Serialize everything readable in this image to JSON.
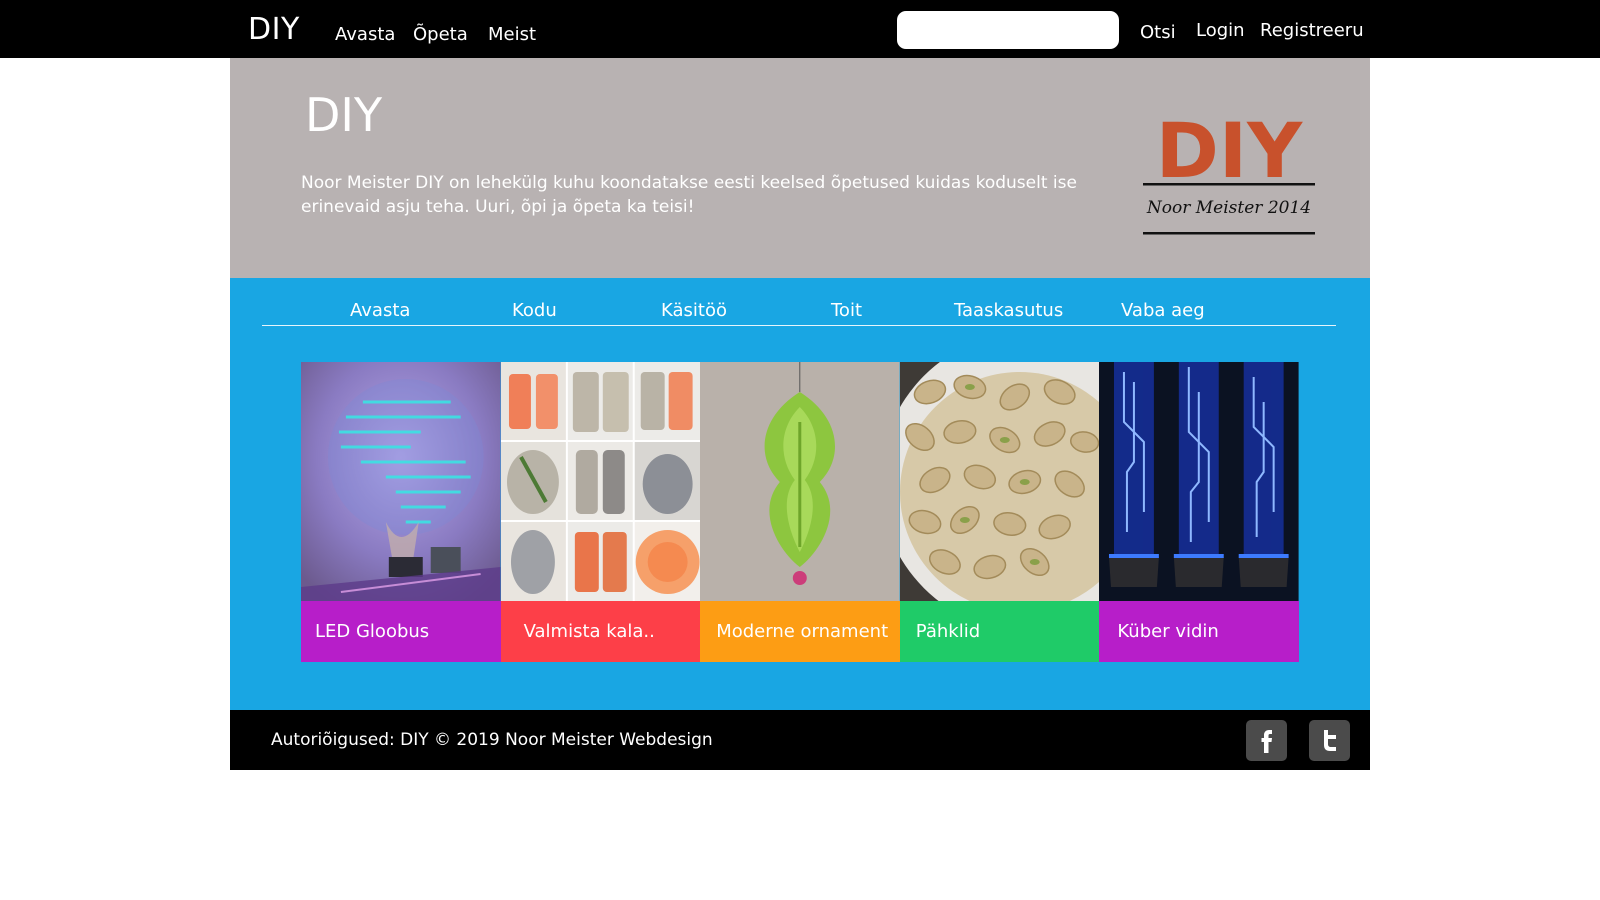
{
  "topbar": {
    "brand": "DIY",
    "nav": [
      {
        "label": "Avasta"
      },
      {
        "label": "Õpeta"
      },
      {
        "label": "Meist"
      }
    ],
    "search": {
      "placeholder": "",
      "value": "",
      "button_label": "Otsi"
    },
    "login_label": "Login",
    "register_label": "Registreeru"
  },
  "hero": {
    "title": "DIY",
    "description": "Noor Meister DIY on lehekülg kuhu koondatakse eesti keelsed õpetused kuidas koduselt ise erinevaid asju teha. Uuri, õpi ja õpeta ka teisi!",
    "logo": {
      "text": "DIY",
      "subtitle": "Noor Meister 2014",
      "color": "#c8512c"
    }
  },
  "categories": [
    {
      "label": "Avasta"
    },
    {
      "label": "Kodu"
    },
    {
      "label": "Käsitöö"
    },
    {
      "label": "Toit"
    },
    {
      "label": "Taaskasutus"
    },
    {
      "label": "Vaba aeg"
    }
  ],
  "cards": [
    {
      "label": "LED Gloobus",
      "color": "#b71ec9",
      "image": "led-globe-photo"
    },
    {
      "label": "Valmista kala..",
      "color": "#fd3f48",
      "image": "salmon-collage-photo"
    },
    {
      "label": "Moderne ornament",
      "color": "#fd9d14",
      "image": "felt-ornament-photo"
    },
    {
      "label": "Pähklid",
      "color": "#1fcb68",
      "image": "pistachio-photo"
    },
    {
      "label": "Küber vidin",
      "color": "#b71ec9",
      "image": "cyber-gadget-photo"
    }
  ],
  "footer": {
    "copyright": "Autoriõigused: DIY © 2019 Noor Meister Webdesign",
    "social": [
      {
        "name": "facebook-icon"
      },
      {
        "name": "twitter-icon"
      }
    ]
  },
  "colors": {
    "topbar_bg": "#000000",
    "hero_bg": "#b8b2b2",
    "content_bg": "#19a6e3",
    "footer_bg": "#000000"
  }
}
